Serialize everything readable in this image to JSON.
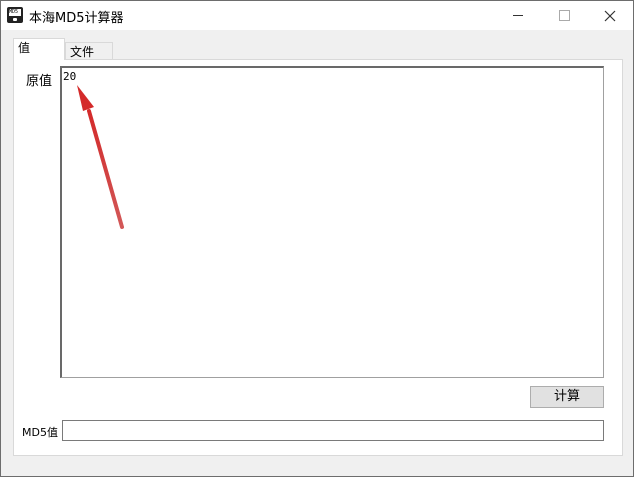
{
  "window": {
    "title": "本海MD5计算器",
    "icon": "md5-app-icon",
    "icon_text": "MD5"
  },
  "tabs": [
    {
      "label": "值",
      "selected": true
    },
    {
      "label": "文件",
      "selected": false
    }
  ],
  "value_tab": {
    "original_label": "原值",
    "original_value": "20",
    "calculate_button": "计算",
    "md5_label": "MD5值",
    "md5_value": ""
  },
  "colors": {
    "annotation_arrow": "#d42a2a",
    "titlebar": "#ffffff",
    "window_bg": "#f0f0f0"
  }
}
